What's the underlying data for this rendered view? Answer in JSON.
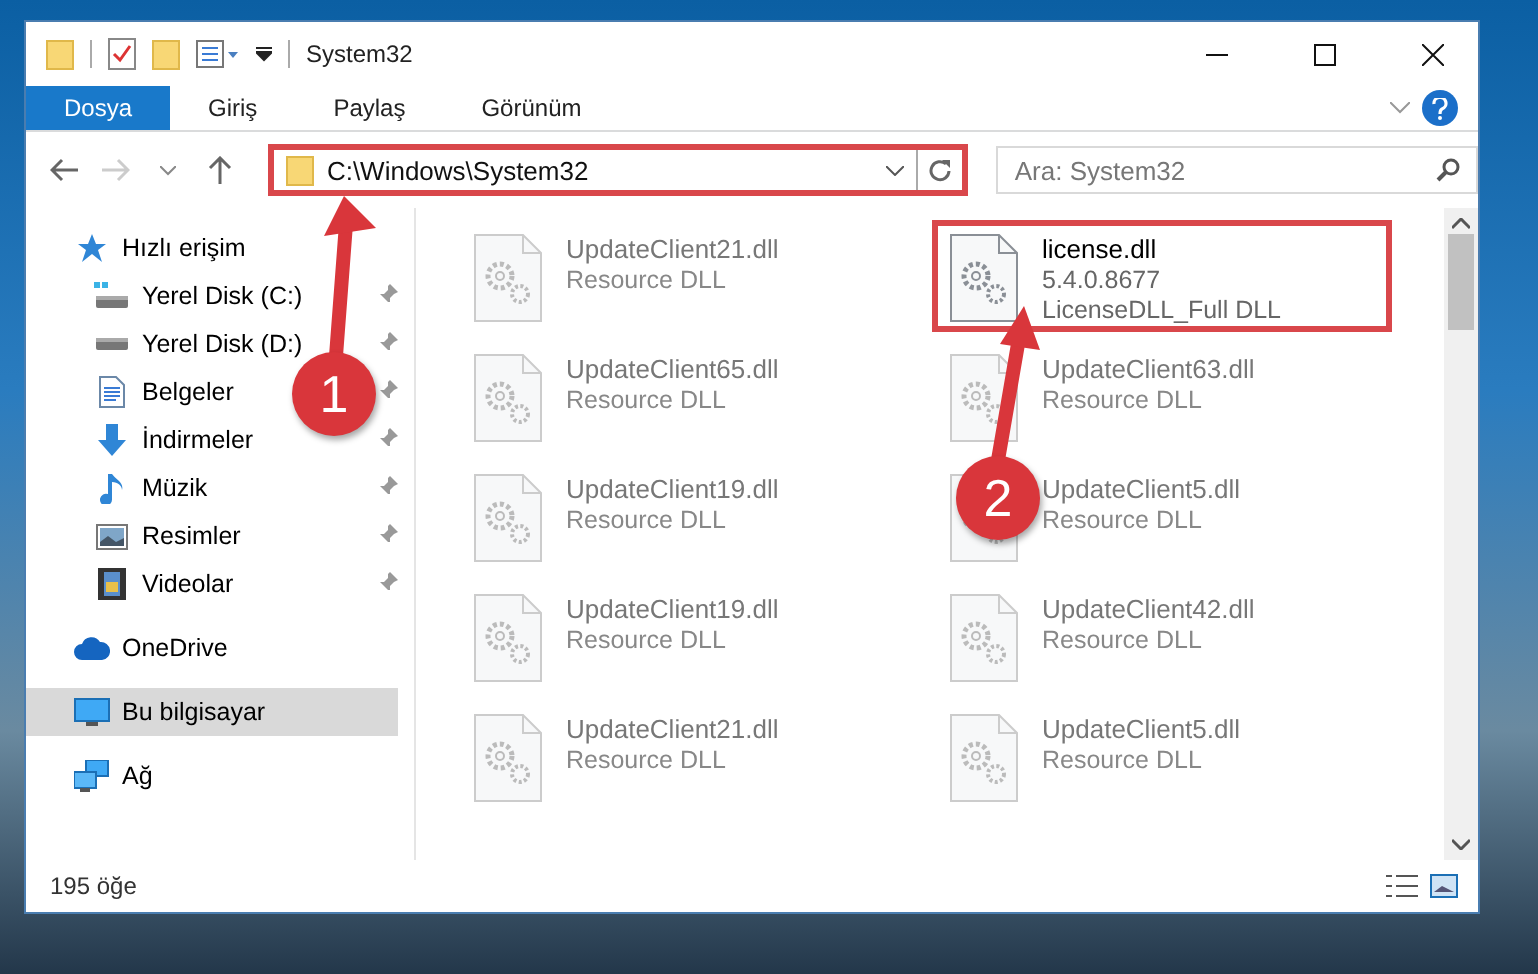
{
  "window": {
    "title": "System32"
  },
  "ribbon_tabs": [
    {
      "label": "Dosya",
      "selected": true
    },
    {
      "label": "Giriş",
      "selected": false
    },
    {
      "label": "Paylaş",
      "selected": false
    },
    {
      "label": "Görünüm",
      "selected": false
    }
  ],
  "address_bar": {
    "value": "C:\\Windows\\System32",
    "highlighted": true
  },
  "search": {
    "placeholder": "Ara: System32"
  },
  "sidebar": {
    "items": [
      {
        "label": "Hızlı erişim",
        "selected": false,
        "children": [
          {
            "label": "Yerel Disk (C:)",
            "pinned": true
          },
          {
            "label": "Yerel Disk (D:)",
            "pinned": true
          },
          {
            "label": "Belgeler",
            "pinned": true
          },
          {
            "label": "İndirmeler",
            "pinned": true
          },
          {
            "label": "Müzik",
            "pinned": true
          },
          {
            "label": "Resimler",
            "pinned": true
          },
          {
            "label": "Videolar",
            "pinned": true
          }
        ]
      },
      {
        "label": "OneDrive",
        "selected": false
      },
      {
        "label": "Bu bilgisayar",
        "selected": true
      },
      {
        "label": "Ağ",
        "selected": false
      }
    ]
  },
  "files": [
    {
      "name": "UpdateClient21.dll",
      "details": [
        "Resource DLL"
      ],
      "blurred": true,
      "highlighted": false
    },
    {
      "name": "license.dll",
      "details": [
        "5.4.0.8677",
        "LicenseDLL_Full DLL"
      ],
      "blurred": false,
      "highlighted": true
    },
    {
      "name": "UpdateClient65.dll",
      "details": [
        "Resource DLL"
      ],
      "blurred": true,
      "highlighted": false
    },
    {
      "name": "UpdateClient63.dll",
      "details": [
        "Resource DLL"
      ],
      "blurred": true,
      "highlighted": false
    },
    {
      "name": "UpdateClient19.dll",
      "details": [
        "Resource DLL"
      ],
      "blurred": true,
      "highlighted": false
    },
    {
      "name": "UpdateClient5.dll",
      "details": [
        "Resource DLL"
      ],
      "blurred": true,
      "highlighted": false
    },
    {
      "name": "UpdateClient19.dll",
      "details": [
        "Resource DLL"
      ],
      "blurred": true,
      "highlighted": false
    },
    {
      "name": "UpdateClient42.dll",
      "details": [
        "Resource DLL"
      ],
      "blurred": true,
      "highlighted": false
    },
    {
      "name": "UpdateClient21.dll",
      "details": [
        "Resource DLL"
      ],
      "blurred": true,
      "highlighted": false
    },
    {
      "name": "UpdateClient5.dll",
      "details": [
        "Resource DLL"
      ],
      "blurred": true,
      "highlighted": false
    }
  ],
  "status_bar": {
    "item_count": "195 öğe"
  },
  "annotations": [
    {
      "label": "1"
    },
    {
      "label": "2"
    }
  ]
}
